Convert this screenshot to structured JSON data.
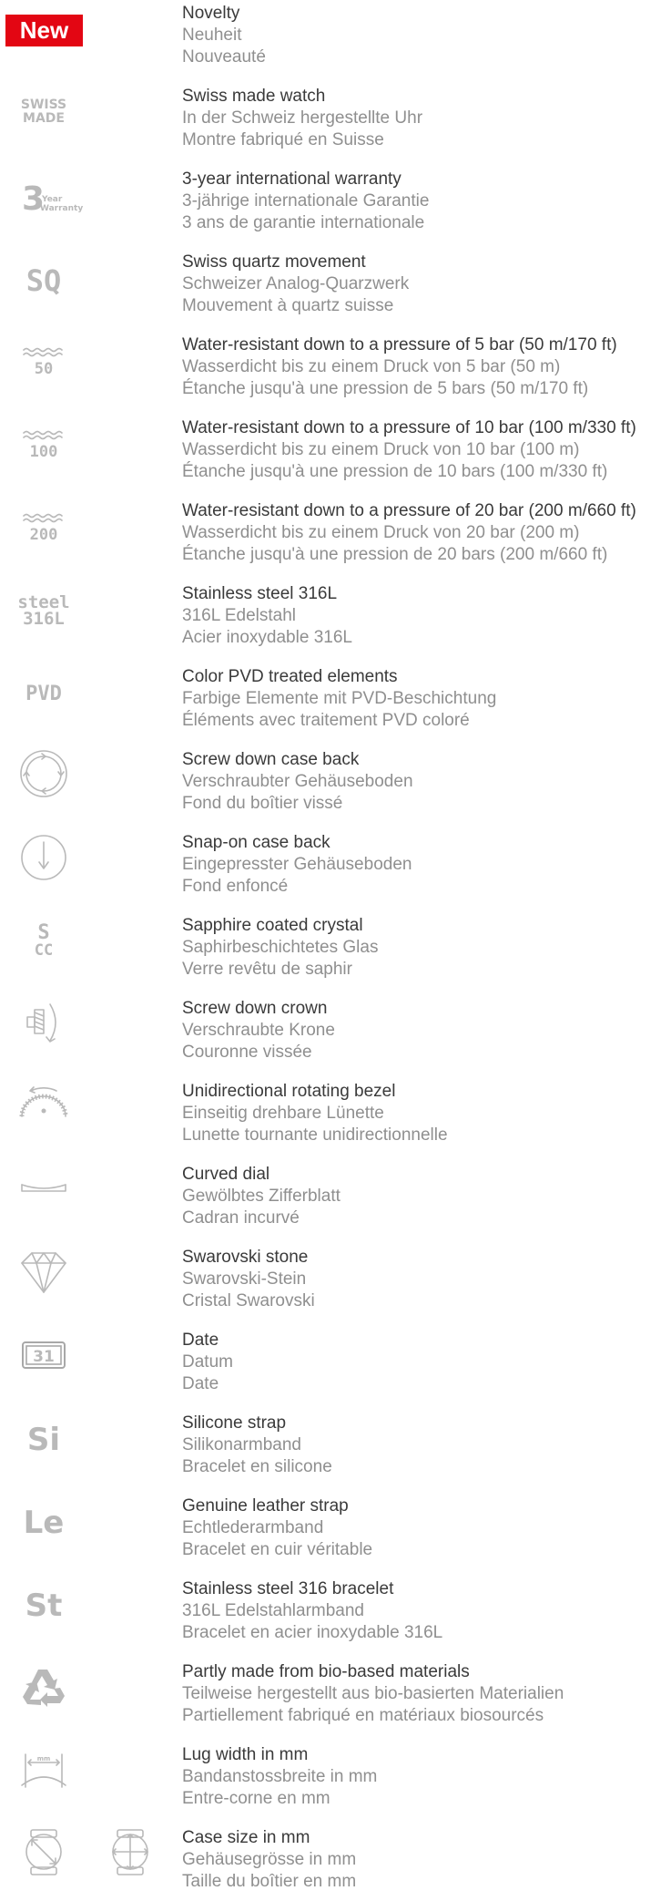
{
  "colors": {
    "new_badge_bg": "#e30613",
    "new_badge_text": "#ffffff",
    "primary_text": "#3a3a3a",
    "secondary_text": "#8f8f8f",
    "icon": "#b9b9b9"
  },
  "items": [
    {
      "icon": "new-badge-icon",
      "icon_text": "New",
      "en": "Novelty",
      "de": "Neuheit",
      "fr": "Nouveauté"
    },
    {
      "icon": "swiss-made-icon",
      "icon_text": [
        "SWISS",
        "MADE"
      ],
      "en": "Swiss made watch",
      "de": "In der Schweiz hergestellte Uhr",
      "fr": "Montre fabriqué en Suisse"
    },
    {
      "icon": "three-year-warranty-icon",
      "icon_text": [
        "3",
        "Year",
        "Warranty"
      ],
      "en": "3-year international warranty",
      "de": "3-jährige internationale Garantie",
      "fr": "3 ans de garantie internationale"
    },
    {
      "icon": "swiss-quartz-icon",
      "icon_text": "SQ",
      "en": "Swiss quartz movement",
      "de": "Schweizer Analog-Quarzwerk",
      "fr": "Mouvement à quartz suisse"
    },
    {
      "icon": "water-resistant-50-icon",
      "icon_text": "50",
      "en": "Water-resistant down to a pressure of 5 bar (50 m/170 ft)",
      "de": "Wasserdicht bis zu einem Druck von 5 bar (50 m)",
      "fr": "Étanche jusqu'à une pression de 5 bars (50 m/170 ft)"
    },
    {
      "icon": "water-resistant-100-icon",
      "icon_text": "100",
      "en": "Water-resistant down to a pressure of 10 bar (100 m/330 ft)",
      "de": "Wasserdicht bis zu einem Druck von 10 bar (100 m)",
      "fr": "Étanche jusqu'à une pression de 10 bars (100 m/330 ft)"
    },
    {
      "icon": "water-resistant-200-icon",
      "icon_text": "200",
      "en": "Water-resistant down to a pressure of 20 bar (200 m/660 ft)",
      "de": "Wasserdicht bis zu einem Druck von 20 bar (200 m)",
      "fr": "Étanche jusqu'à une pression de 20 bars (200 m/660 ft)"
    },
    {
      "icon": "steel-316l-icon",
      "icon_text": [
        "steel",
        "316L"
      ],
      "en": "Stainless steel 316L",
      "de": "316L Edelstahl",
      "fr": "Acier inoxydable 316L"
    },
    {
      "icon": "pvd-icon",
      "icon_text": "PVD",
      "en": "Color PVD treated elements",
      "de": "Farbige Elemente mit PVD-Beschichtung",
      "fr": "Éléments avec traitement PVD coloré"
    },
    {
      "icon": "screw-down-case-back-icon",
      "en": "Screw down case back",
      "de": "Verschraubter Gehäuseboden",
      "fr": "Fond du boîtier vissé"
    },
    {
      "icon": "snap-on-case-back-icon",
      "en": "Snap-on case back",
      "de": "Eingepresster Gehäuseboden",
      "fr": "Fond enfoncé"
    },
    {
      "icon": "sapphire-coated-crystal-icon",
      "icon_text": [
        "S",
        "CC"
      ],
      "en": "Sapphire coated crystal",
      "de": "Saphirbeschichtetes Glas",
      "fr": "Verre revêtu de saphir"
    },
    {
      "icon": "screw-down-crown-icon",
      "en": "Screw down crown",
      "de": "Verschraubte Krone",
      "fr": "Couronne vissée"
    },
    {
      "icon": "unidirectional-bezel-icon",
      "en": "Unidirectional rotating bezel",
      "de": "Einseitig drehbare Lünette",
      "fr": "Lunette tournante unidirectionnelle"
    },
    {
      "icon": "curved-dial-icon",
      "en": "Curved dial",
      "de": "Gewölbtes Zifferblatt",
      "fr": "Cadran incurvé"
    },
    {
      "icon": "swarovski-stone-icon",
      "en": "Swarovski stone",
      "de": "Swarovski-Stein",
      "fr": "Cristal Swarovski"
    },
    {
      "icon": "date-icon",
      "icon_text": "31",
      "en": "Date",
      "de": "Datum",
      "fr": "Date"
    },
    {
      "icon": "silicone-icon",
      "icon_text": "Si",
      "en": "Silicone strap",
      "de": "Silikonarmband",
      "fr": "Bracelet en silicone"
    },
    {
      "icon": "leather-icon",
      "icon_text": "Le",
      "en": "Genuine leather strap",
      "de": "Echtlederarmband",
      "fr": "Bracelet en cuir véritable"
    },
    {
      "icon": "steel-bracelet-icon",
      "icon_text": "St",
      "en": "Stainless steel 316 bracelet",
      "de": "316L Edelstahlarmband",
      "fr": "Bracelet en acier inoxydable 316L"
    },
    {
      "icon": "recycle-icon",
      "en": "Partly made from bio-based materials",
      "de": "Teilweise hergestellt aus bio-basierten Materialien",
      "fr": "Partiellement fabriqué en matériaux biosourcés"
    },
    {
      "icon": "lug-width-icon",
      "icon_text": "mm",
      "en": "Lug width in mm",
      "de": "Bandanstossbreite in mm",
      "fr": "Entre-corne en mm"
    },
    {
      "icon": "case-size-icon",
      "en": "Case size in mm",
      "de": "Gehäusegrösse in mm",
      "fr": "Taille du boîtier en mm"
    }
  ]
}
